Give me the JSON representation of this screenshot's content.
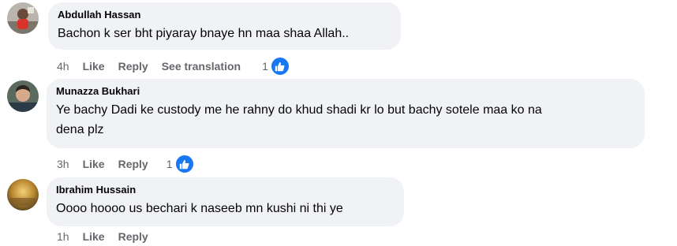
{
  "comments": [
    {
      "author": "Abdullah Hassan",
      "text_lines": [
        "Bachon k ser bht piyaray bnaye hn maa shaa Allah.."
      ],
      "time": "4h",
      "like_label": "Like",
      "reply_label": "Reply",
      "translate_label": "See translation",
      "reaction_count": "1",
      "avatar_icon": "profile-photo-icon"
    },
    {
      "author": "Munazza Bukhari",
      "text_lines": [
        "Ye bachy Dadi ke custody me he rahny do khud shadi kr lo but bachy sotele maa ko na",
        "dena plz"
      ],
      "time": "3h",
      "like_label": "Like",
      "reply_label": "Reply",
      "reaction_count": "1",
      "avatar_icon": "profile-photo-icon"
    },
    {
      "author": "Ibrahim Hussain",
      "text_lines": [
        "Oooo hoooo us bechari k naseeb mn kushi ni thi ye"
      ],
      "time": "1h",
      "like_label": "Like",
      "reply_label": "Reply",
      "avatar_icon": "profile-photo-icon"
    }
  ],
  "colors": {
    "bubble_bg": "#f0f2f5",
    "meta_text": "#65676b",
    "like_badge": "#1877f2"
  }
}
